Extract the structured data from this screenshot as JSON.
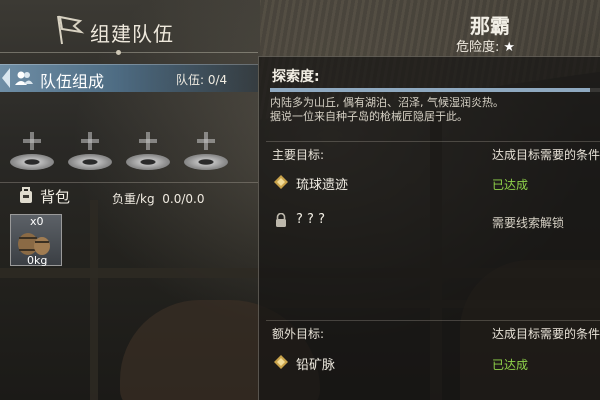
{
  "header": {
    "title": "组建队伍",
    "location_name": "那霸",
    "danger_label": "危险度:",
    "danger_star": "★"
  },
  "team": {
    "label": "队伍组成",
    "count_label": "队伍:",
    "count_value": "0/4",
    "slots": 4
  },
  "backpack": {
    "label": "背包",
    "weight_label": "负重/kg",
    "weight_value": "0.0/0.0",
    "item": {
      "count": "x0",
      "weight": "0kg",
      "icon": "barrel-icon"
    }
  },
  "exploration": {
    "label": "探索度:",
    "progress": 0.97,
    "description_lines": [
      "内陆多为山丘, 偶有湖泊、沼泽, 气候湿润炎热。",
      "据说一位来自种子岛的枪械匠隐居于此。"
    ]
  },
  "main_goals": {
    "title": "主要目标:",
    "condition_header": "达成目标需要的条件",
    "items": [
      {
        "name": "琉球遗迹",
        "status": "已达成",
        "icon": "diamond-icon"
      },
      {
        "name": "? ? ?",
        "status": "需要线索解锁",
        "icon": "lock-icon"
      }
    ]
  },
  "extra_goals": {
    "title": "额外目标:",
    "condition_header": "达成目标需要的条件",
    "items": [
      {
        "name": "铅矿脉",
        "status": "已达成",
        "icon": "diamond-icon"
      }
    ]
  },
  "colors": {
    "achieved": "#8fd24a",
    "team_bar": "#6f8ea6",
    "progress": "#8fa9c0"
  }
}
